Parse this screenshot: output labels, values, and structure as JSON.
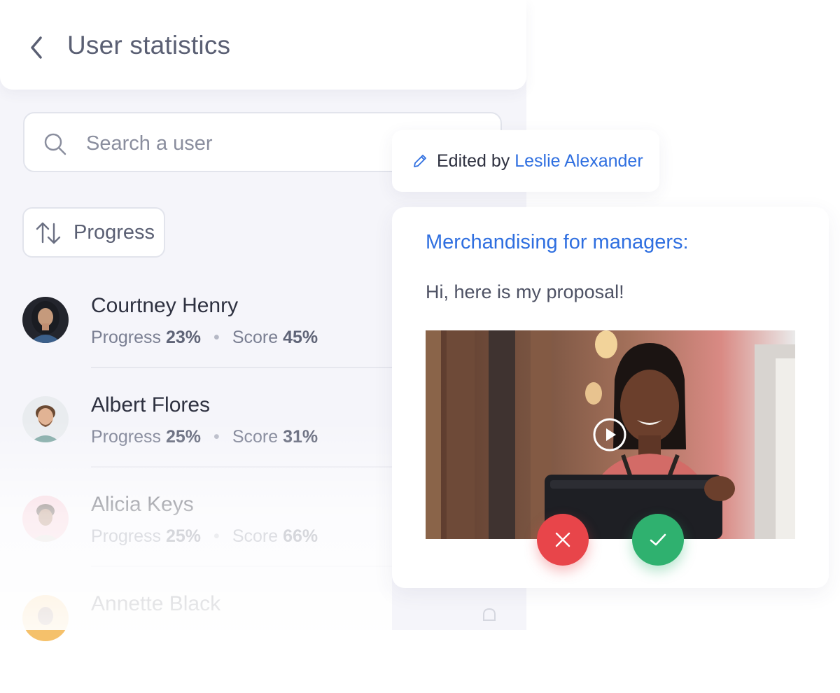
{
  "header": {
    "title": "User statistics"
  },
  "search": {
    "placeholder": "Search a user"
  },
  "sort": {
    "label": "Progress"
  },
  "users": [
    {
      "name": "Courtney Henry",
      "progress_label": "Progress",
      "progress": "23%",
      "score_label": "Score",
      "score": "45%"
    },
    {
      "name": "Albert Flores",
      "progress_label": "Progress",
      "progress": "25%",
      "score_label": "Score",
      "score": "31%"
    },
    {
      "name": "Alicia Keys",
      "progress_label": "Progress",
      "progress": "25%",
      "score_label": "Score",
      "score": "66%"
    },
    {
      "name": "Annette Black"
    }
  ],
  "edited": {
    "prefix": "Edited by",
    "name": "Leslie Alexander"
  },
  "proposal": {
    "title": "Merchandising for managers:",
    "message": "Hi, here is my proposal!"
  },
  "icons": [
    "back-icon",
    "search-icon",
    "sort-icon",
    "pencil-icon",
    "play-icon",
    "close-icon",
    "check-icon",
    "bell-icon"
  ],
  "colors": {
    "accent": "#2f6fe0",
    "reject": "#e8454a",
    "accept": "#2fb16f",
    "text": "#2e3140",
    "muted": "#7a7f92"
  }
}
